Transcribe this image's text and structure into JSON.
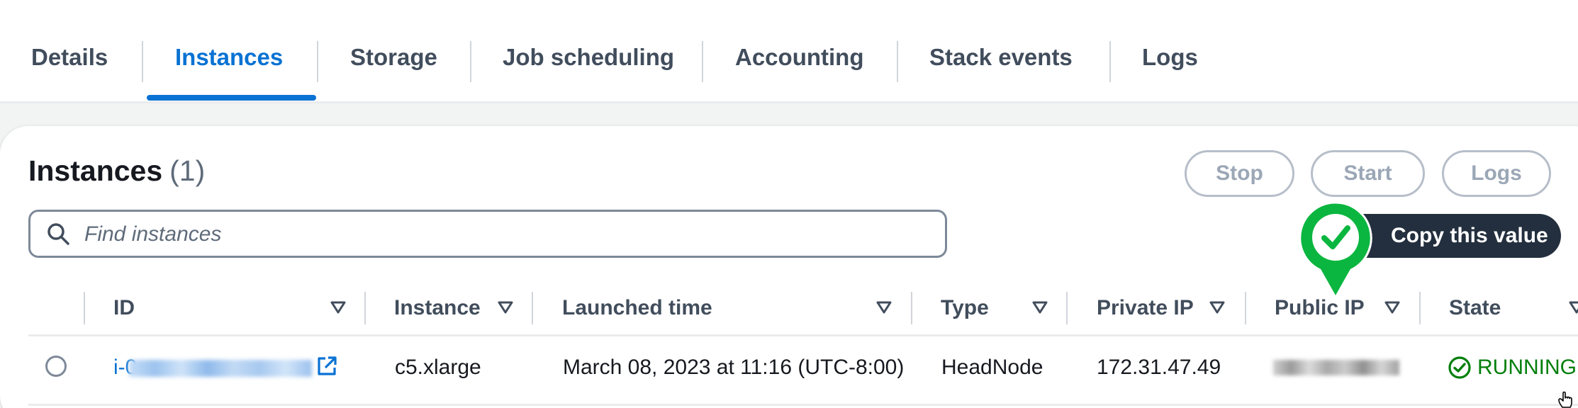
{
  "tabs": [
    {
      "label": "Details",
      "active": false
    },
    {
      "label": "Instances",
      "active": true
    },
    {
      "label": "Storage",
      "active": false
    },
    {
      "label": "Job scheduling",
      "active": false
    },
    {
      "label": "Accounting",
      "active": false
    },
    {
      "label": "Stack events",
      "active": false
    },
    {
      "label": "Logs",
      "active": false
    }
  ],
  "instances": {
    "title": "Instances",
    "count": "(1)",
    "actions": {
      "stop_label": "Stop",
      "start_label": "Start",
      "logs_label": "Logs"
    },
    "search": {
      "placeholder": "Find instances",
      "value": ""
    },
    "table": {
      "columns": [
        "ID",
        "Instance",
        "Launched time",
        "Type",
        "Private IP",
        "Public IP",
        "State"
      ],
      "rows": [
        {
          "id_prefix": "i-0",
          "instance": "c5.xlarge",
          "launched_time": "March 08, 2023 at 11:16 (UTC-8:00)",
          "type": "HeadNode",
          "private_ip": "172.31.47.49",
          "state": "RUNNING"
        }
      ]
    }
  },
  "tooltip": {
    "text": "Copy this value"
  },
  "icons": {
    "search": "search-icon",
    "sort": "caret-down-outline-icon",
    "external_link": "external-link-icon",
    "status": "status-check-circle-icon",
    "copy_confirm": "check-badge-icon",
    "cursor": "hand-cursor-icon"
  },
  "colors": {
    "accent": "#0972d3",
    "success": "#037f0c",
    "badge_green": "#0ab63f",
    "tooltip_bg": "#232f3e",
    "disabled": "#9ba7b6"
  }
}
